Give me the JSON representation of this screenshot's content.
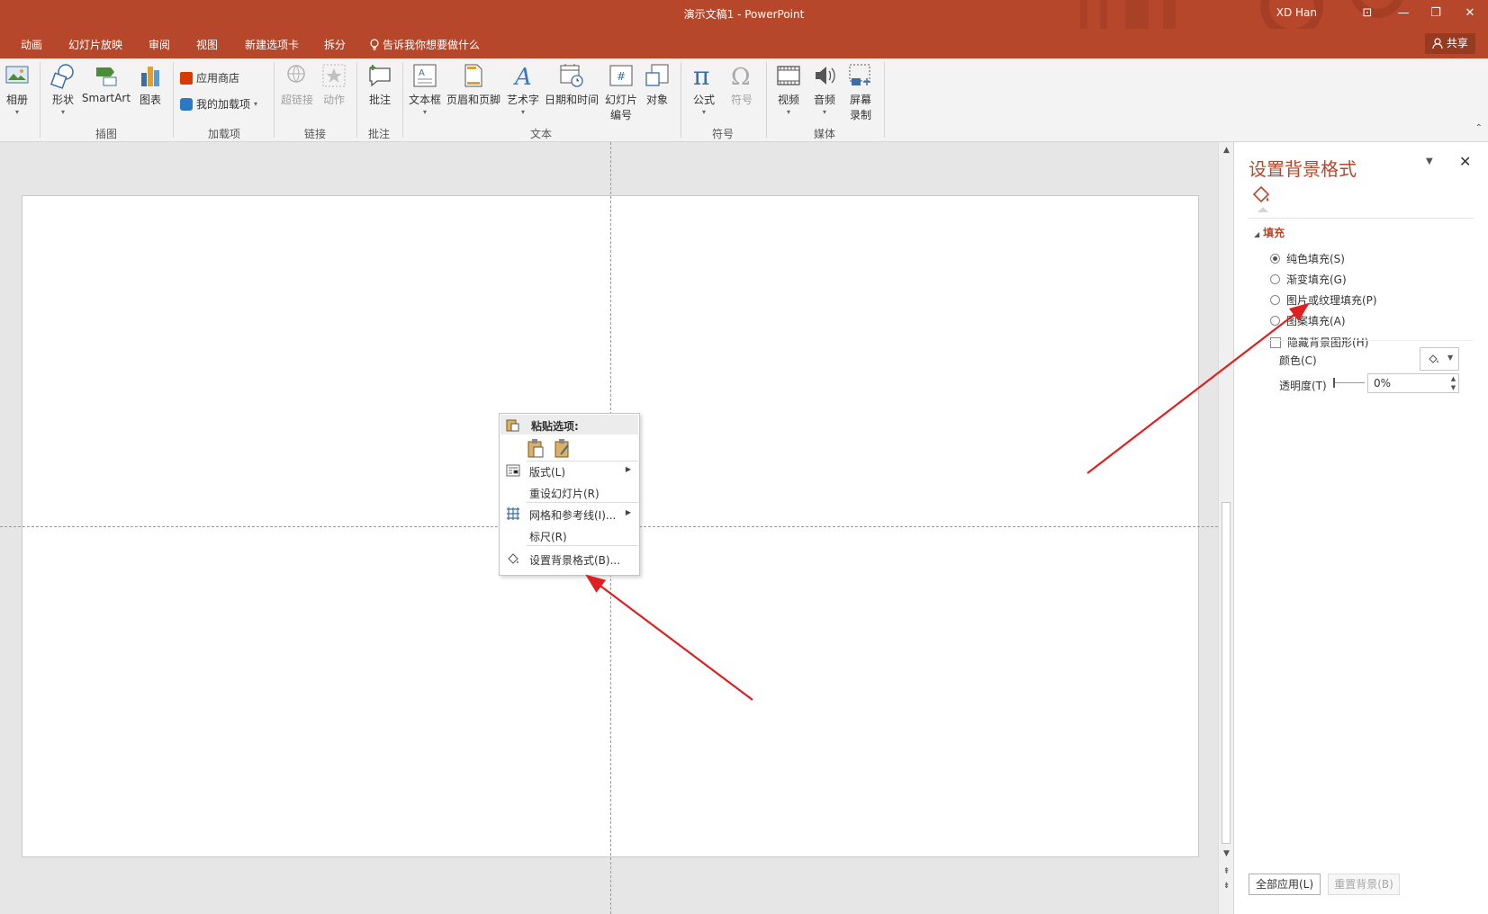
{
  "window": {
    "title": "演示文稿1 - PowerPoint",
    "user_name": "XD Han",
    "controls": {
      "ribbon_display": "⊡",
      "minimize": "—",
      "restore": "❐",
      "close": "✕"
    }
  },
  "tabs": [
    "动画",
    "幻灯片放映",
    "审阅",
    "视图",
    "新建选项卡",
    "拆分"
  ],
  "tell_me": "告诉我你想要做什么",
  "share_label": "共享",
  "ribbon": {
    "album": "相册",
    "shapes": "形状",
    "smartart": "SmartArt",
    "chart": "图表",
    "group_illustrations": "插图",
    "store": "应用商店",
    "my_addins": "我的加载项",
    "group_addins": "加载项",
    "hyperlink": "超链接",
    "action": "动作",
    "group_links": "链接",
    "comment": "批注",
    "group_comments": "批注",
    "textbox": "文本框",
    "header_footer": "页眉和页脚",
    "wordart": "艺术字",
    "datetime": "日期和时间",
    "slide_number_line1": "幻灯片",
    "slide_number_line2": "编号",
    "object": "对象",
    "group_text": "文本",
    "equation": "公式",
    "symbol": "符号",
    "group_symbols": "符号",
    "video": "视频",
    "audio": "音频",
    "screen_rec_line1": "屏幕",
    "screen_rec_line2": "录制",
    "group_media": "媒体"
  },
  "context_menu": {
    "paste_options": "粘贴选项:",
    "items": [
      {
        "label": "版式(L)"
      },
      {
        "label": "重设幻灯片(R)"
      },
      {
        "label": "网格和参考线(I)..."
      },
      {
        "label": "标尺(R)"
      },
      {
        "label": "设置背景格式(B)..."
      }
    ]
  },
  "pane": {
    "title": "设置背景格式",
    "fill_section": "填充",
    "options": [
      {
        "label": "纯色填充(S)",
        "selected": true
      },
      {
        "label": "渐变填充(G)",
        "selected": false
      },
      {
        "label": "图片或纹理填充(P)",
        "selected": false
      },
      {
        "label": "图案填充(A)",
        "selected": false
      }
    ],
    "hide_bg_graphics": "隐藏背景图形(H)",
    "color_label": "颜色(C)",
    "transparency_label": "透明度(T)",
    "transparency_value": "0%",
    "apply_all": "全部应用(L)",
    "reset_bg": "重置背景(B)"
  },
  "colors": {
    "accent": "#b7472a",
    "annotation_arrow": "#e02020"
  }
}
